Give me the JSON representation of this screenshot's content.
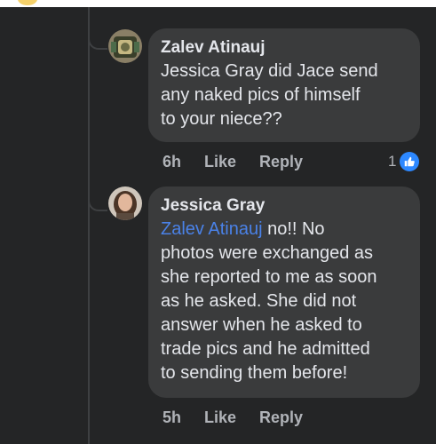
{
  "comments": [
    {
      "author": "Zalev Atinauj",
      "lines": [
        "Jessica Gray did Jace send",
        "any naked pics of himself",
        "to your niece??"
      ],
      "time": "6h",
      "like_label": "Like",
      "reply_label": "Reply",
      "reaction_count": "1"
    },
    {
      "author": "Jessica Gray",
      "mention": "Zalev Atinauj",
      "first_line_rest": " no!! No",
      "lines": [
        "photos were exchanged as",
        "she reported to me as soon",
        "as he asked. She did not",
        "answer when he asked to",
        "trade pics and he admitted",
        "to sending them before!"
      ],
      "time": "5h",
      "like_label": "Like",
      "reply_label": "Reply"
    }
  ],
  "colors": {
    "background": "#242526",
    "bubble": "#3a3b3c",
    "mention": "#4a82e8",
    "like_badge": "#2d88ff"
  }
}
